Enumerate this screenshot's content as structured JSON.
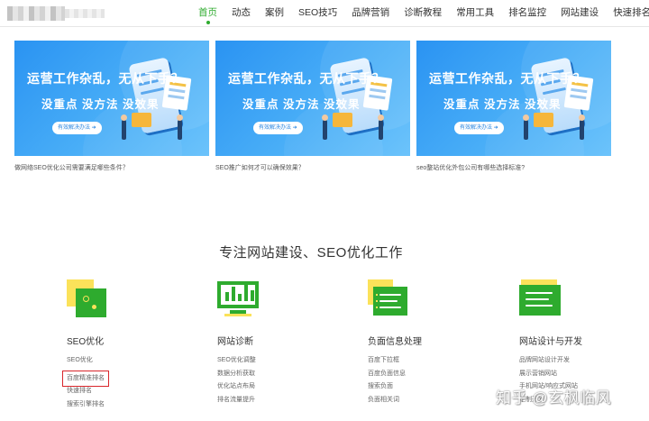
{
  "nav": {
    "items": [
      "首页",
      "动态",
      "案例",
      "SEO技巧",
      "品牌营销",
      "诊断教程",
      "常用工具",
      "排名监控",
      "网站建设",
      "快速排名"
    ],
    "active_index": 0,
    "active_color": "#2eab2e"
  },
  "cards": [
    {
      "title": "运营工作杂乱，无从下手？",
      "subtitle": "没重点 没方法 没效果",
      "button": "有效解决办法 ➜",
      "caption": "做网络SEO优化公司需要满足哪些条件？"
    },
    {
      "title": "运营工作杂乱，无从下手？",
      "subtitle": "没重点 没方法 没效果",
      "button": "有效解决办法 ➜",
      "caption": "SEO推广如何才可以确保效果？"
    },
    {
      "title": "运营工作杂乱，无从下手？",
      "subtitle": "没重点 没方法 没效果",
      "button": "有效解决办法 ➜",
      "caption": "seo整站优化外包公司有哪些选择标准?"
    }
  ],
  "section": {
    "title": "专注网站建设、SEO优化工作"
  },
  "services": [
    {
      "title": "SEO优化",
      "icon": "seo-icon",
      "items": [
        "SEO优化",
        "百度精准排名",
        "快速排名",
        "搜索引擎排名"
      ],
      "highlight_index": 1
    },
    {
      "title": "网站诊断",
      "icon": "monitor-chart-icon",
      "items": [
        "SEO优化调整",
        "数据分析获取",
        "优化站点布局",
        "排名流量提升"
      ]
    },
    {
      "title": "负面信息处理",
      "icon": "document-list-icon",
      "items": [
        "百度下拉框",
        "百度负面信息",
        "搜索负面",
        "负面相关词"
      ]
    },
    {
      "title": "网站设计与开发",
      "icon": "web-panel-icon",
      "items": [
        "品牌网站设计开发",
        "展示营销网站",
        "手机网站/响应式网站",
        "定制开发"
      ]
    }
  ],
  "colors": {
    "brand_green": "#2eab2e",
    "accent_yellow": "#fbe25a",
    "banner_blue": "#2a93f2",
    "highlight_red": "#d9262b"
  },
  "watermark": "知乎 @玄枫临风"
}
